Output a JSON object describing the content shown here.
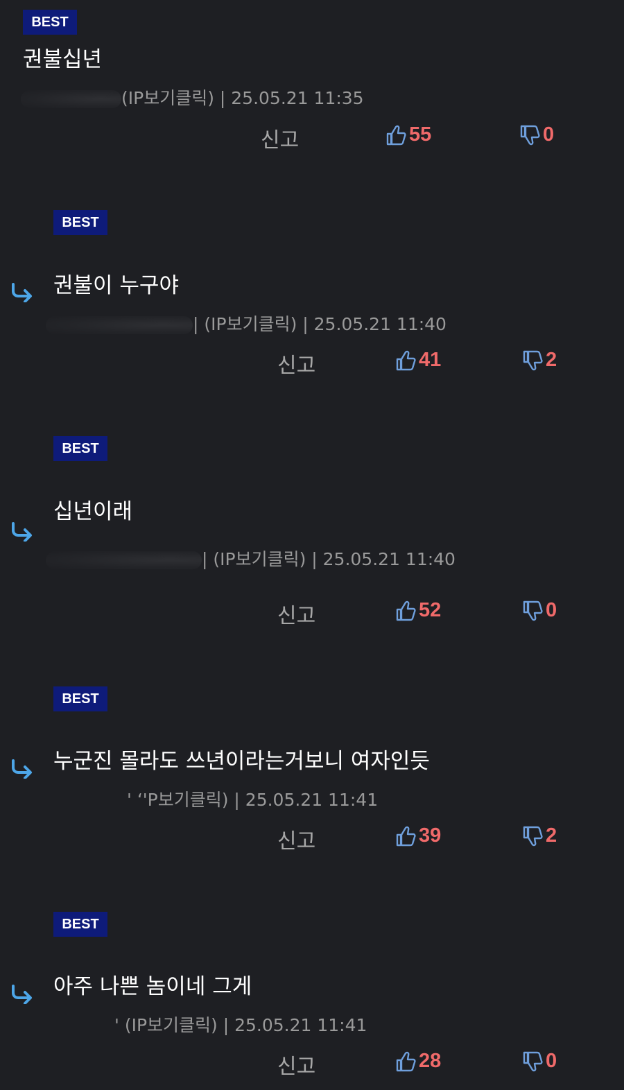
{
  "colors": {
    "background": "#1e1f23",
    "badge": "#0e1b7a",
    "vote_count": "#f06a6a",
    "thumb_icon": "#6f9fdc",
    "reply_arrow": "#4da6e8"
  },
  "comments": [
    {
      "badge": "BEST",
      "content": "권불십년",
      "meta": "(IP보기클릭) | 25.05.21 11:35",
      "report": "신고",
      "likes": "55",
      "dislikes": "0",
      "is_reply": false
    },
    {
      "badge": "BEST",
      "content": "권불이 누구야",
      "meta": "| (IP보기클릭) | 25.05.21 11:40",
      "report": "신고",
      "likes": "41",
      "dislikes": "2",
      "is_reply": true
    },
    {
      "badge": "BEST",
      "content": "십년이래",
      "meta": "| (IP보기클릭) | 25.05.21 11:40",
      "report": "신고",
      "likes": "52",
      "dislikes": "0",
      "is_reply": true
    },
    {
      "badge": "BEST",
      "content": "누군진 몰라도 쓰년이라는거보니 여자인듯",
      "meta": "' ‘'P보기클릭) | 25.05.21 11:41",
      "report": "신고",
      "likes": "39",
      "dislikes": "2",
      "is_reply": true
    },
    {
      "badge": "BEST",
      "content": "아주 나쁜 놈이네 그게",
      "meta": "' (IP보기클릭) | 25.05.21 11:41",
      "report": "신고",
      "likes": "28",
      "dislikes": "0",
      "is_reply": true
    }
  ]
}
